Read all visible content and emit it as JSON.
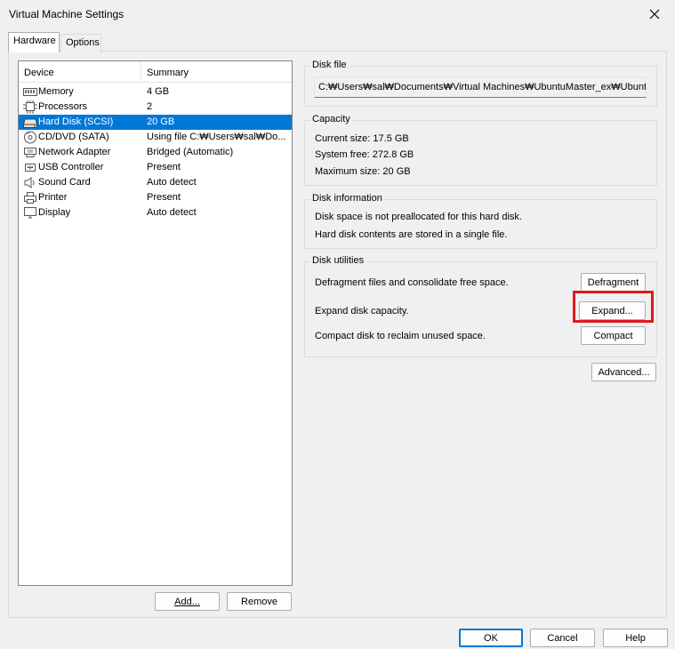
{
  "window": {
    "title": "Virtual Machine Settings"
  },
  "tabs": [
    {
      "label": "Hardware"
    },
    {
      "label": "Options"
    }
  ],
  "device_list": {
    "headers": {
      "device": "Device",
      "summary": "Summary"
    },
    "rows": [
      {
        "device": "Memory",
        "summary": "4 GB",
        "icon": "memory-icon"
      },
      {
        "device": "Processors",
        "summary": "2",
        "icon": "processor-icon"
      },
      {
        "device": "Hard Disk (SCSI)",
        "summary": "20 GB",
        "icon": "hard-disk-icon",
        "selected": true
      },
      {
        "device": "CD/DVD (SATA)",
        "summary": "Using file C:₩Users₩sal₩Do...",
        "icon": "cd-dvd-icon"
      },
      {
        "device": "Network Adapter",
        "summary": "Bridged (Automatic)",
        "icon": "network-adapter-icon"
      },
      {
        "device": "USB Controller",
        "summary": "Present",
        "icon": "usb-icon"
      },
      {
        "device": "Sound Card",
        "summary": "Auto detect",
        "icon": "speaker-icon"
      },
      {
        "device": "Printer",
        "summary": "Present",
        "icon": "printer-icon"
      },
      {
        "device": "Display",
        "summary": "Auto detect",
        "icon": "monitor-icon"
      }
    ]
  },
  "list_buttons": {
    "add_label": "Add...",
    "remove_label": "Remove"
  },
  "disk_file": {
    "group_label": "Disk file",
    "path": "C:₩Users₩sal₩Documents₩Virtual Machines₩UbuntuMaster_ex₩Ubuntu"
  },
  "capacity": {
    "group_label": "Capacity",
    "current_size": "Current size:  17.5 GB",
    "system_free": "System free:  272.8 GB",
    "maximum_size": "Maximum size:  20 GB"
  },
  "disk_information": {
    "group_label": "Disk information",
    "line1": "Disk space is not preallocated for this hard disk.",
    "line2": "Hard disk contents are stored in a single file."
  },
  "disk_utilities": {
    "group_label": "Disk utilities",
    "defrag_text": "Defragment files and consolidate free space.",
    "defrag_button": "Defragment",
    "expand_text": "Expand disk capacity.",
    "expand_button": "Expand...",
    "compact_text": "Compact disk to reclaim unused space.",
    "compact_button": "Compact"
  },
  "advanced_button": "Advanced...",
  "footer": {
    "ok_label": "OK",
    "cancel_label": "Cancel",
    "help_label": "Help"
  },
  "colors": {
    "selection": "#0078d7",
    "highlight_box": "#e3171f",
    "window_bg": "#f0f0f0"
  }
}
